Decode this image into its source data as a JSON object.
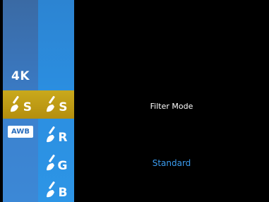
{
  "menu": {
    "resolution_label": "4K",
    "white_balance_label": "AWB",
    "filter_options": [
      {
        "icon": "brush-icon",
        "letter": "S",
        "selected": true
      },
      {
        "icon": "brush-icon",
        "letter": "R",
        "selected": false
      },
      {
        "icon": "brush-icon",
        "letter": "G",
        "selected": false
      },
      {
        "icon": "brush-icon",
        "letter": "B",
        "selected": false
      }
    ],
    "column1_selected_icon": {
      "icon": "brush-icon",
      "letter": "S"
    }
  },
  "content": {
    "title": "Filter Mode",
    "value": "Standard"
  },
  "colors": {
    "background": "#000000",
    "selection": "#c2a016",
    "menu_blue": "#2b8ee0",
    "value_text": "#3b9cf0"
  }
}
